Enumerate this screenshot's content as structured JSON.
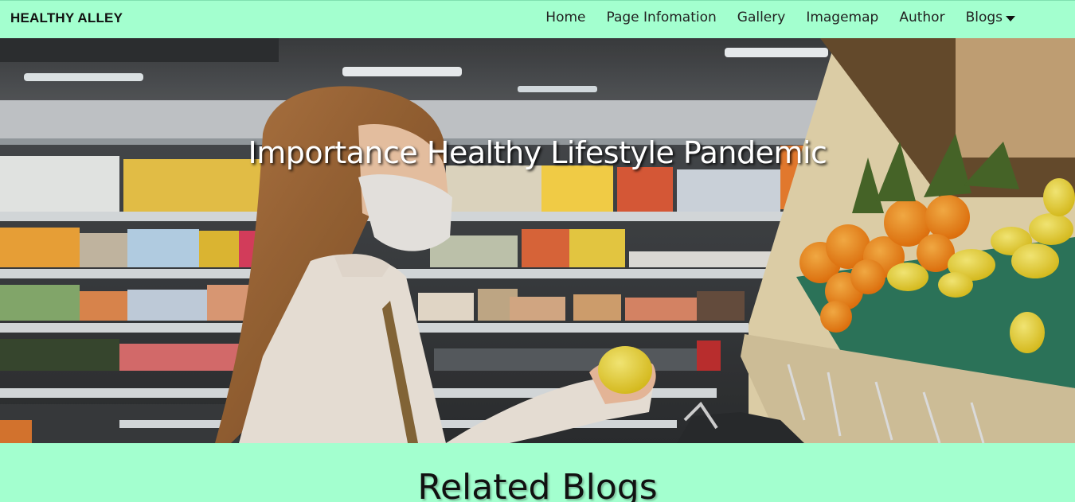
{
  "brand": "HEALTHY ALLEY",
  "nav": {
    "items": [
      {
        "label": "Home"
      },
      {
        "label": "Page Infomation"
      },
      {
        "label": "Gallery"
      },
      {
        "label": "Imagemap"
      },
      {
        "label": "Author"
      },
      {
        "label": "Blogs"
      }
    ]
  },
  "hero": {
    "title": "Importance Healthy Lifestyle Pandemic"
  },
  "related": {
    "title": "Related Blogs"
  },
  "colors": {
    "navbar_bg": "#a3ffcf",
    "page_bg": "#a3ffcf"
  }
}
